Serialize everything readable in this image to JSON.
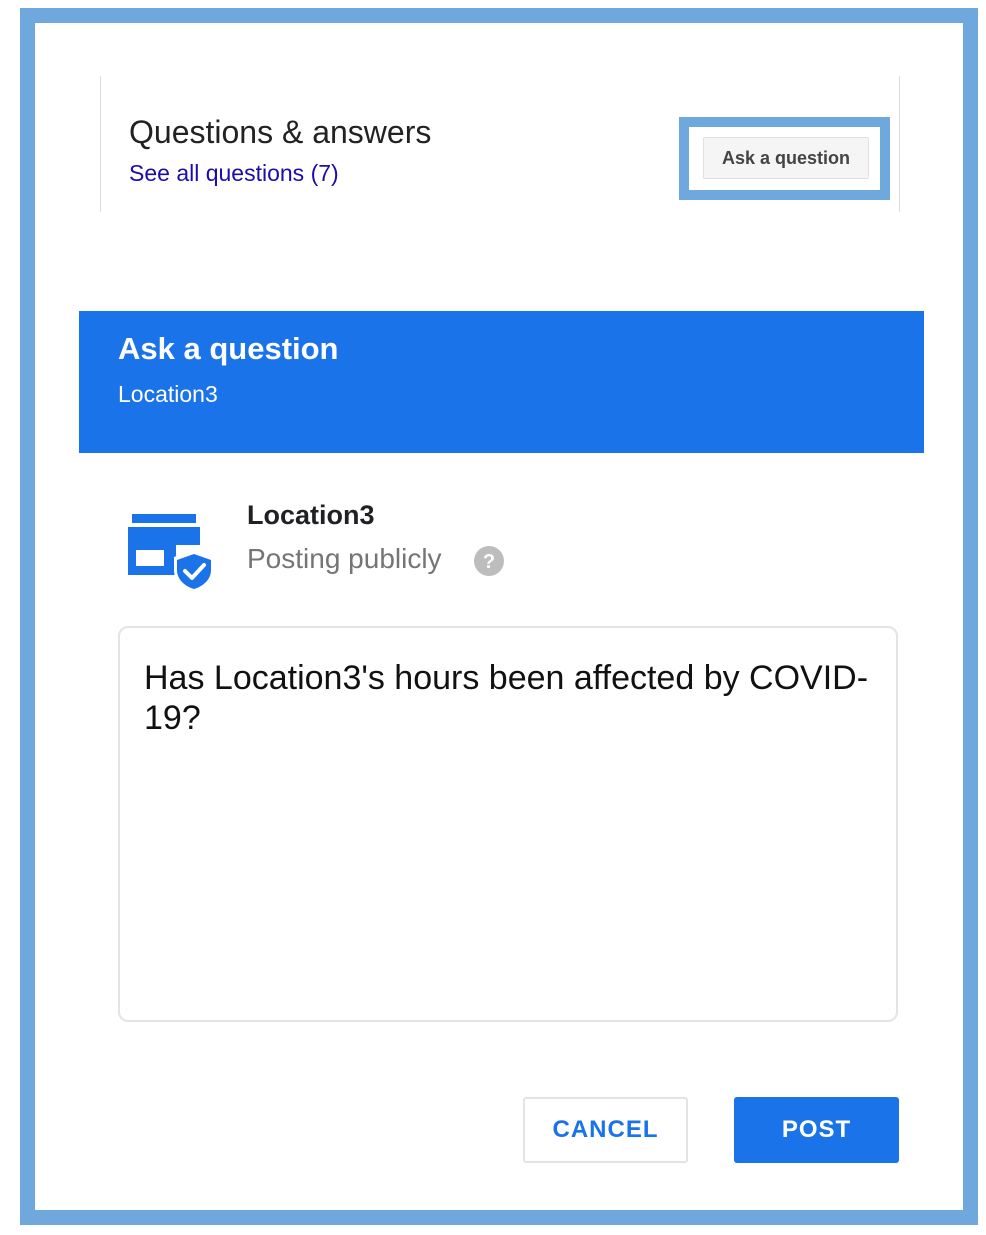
{
  "qa_card": {
    "title": "Questions & answers",
    "see_all_link": "See all questions (7)",
    "ask_button_label": "Ask a question"
  },
  "dialog": {
    "title": "Ask a question",
    "subtitle": "Location3",
    "poster": {
      "name": "Location3",
      "status": "Posting publicly",
      "icon": "store-verified-icon",
      "help_icon": "help-icon"
    },
    "question_value": "Has Location3's hours been affected by COVID-19?",
    "cancel_label": "CANCEL",
    "post_label": "POST"
  },
  "colors": {
    "accent": "#1a73e8",
    "highlight": "#6fa8dc",
    "link": "#1a0dab"
  }
}
